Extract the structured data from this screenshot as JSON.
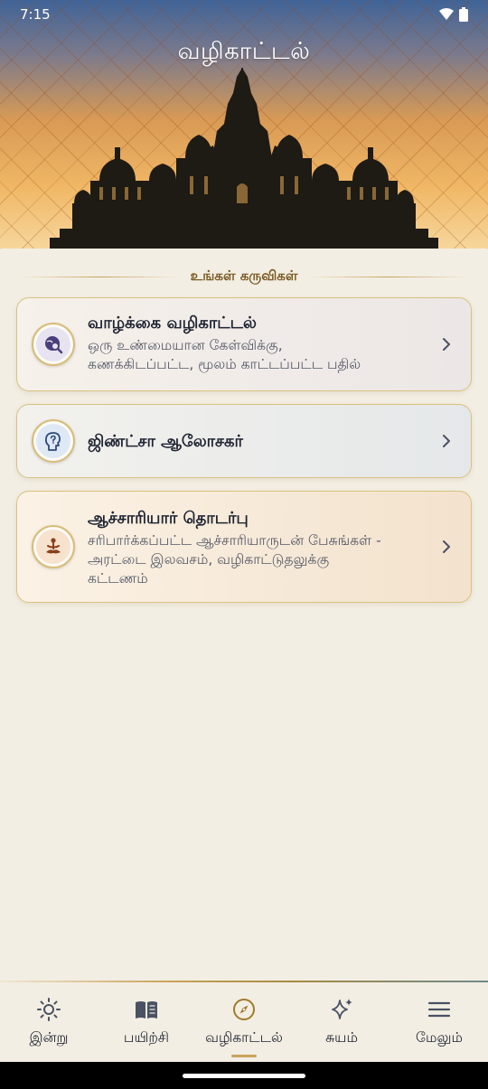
{
  "status_bar": {
    "time": "7:15"
  },
  "header": {
    "title": "வழிகாட்டல்"
  },
  "section": {
    "title": "உங்கள் கருவிகள்"
  },
  "cards": [
    {
      "title": "வாழ்க்கை வழிகாட்டல்",
      "desc_line1": "ஒரு உண்மையான கேள்விக்கு,",
      "desc_line2": "கணக்கிடப்பட்ட, மூலம் காட்டப்பட்ட பதில்",
      "icon": "globe-search-icon"
    },
    {
      "title": "ஜிண்ட்சா ஆலோசகர்",
      "icon": "head-question-icon"
    },
    {
      "title": "ஆச்சாரியார் தொடர்பு",
      "desc_line1": "சரிபார்க்கப்பட்ட ஆச்சாரியாருடன் பேசுங்கள் -",
      "desc_line2": "அரட்டை இலவசம், வழிகாட்டுதலுக்கு",
      "desc_line3": "கட்டணம்",
      "icon": "meditation-icon"
    }
  ],
  "nav": [
    {
      "label": "இன்று",
      "icon": "sun-icon"
    },
    {
      "label": "பயிற்சி",
      "icon": "book-icon"
    },
    {
      "label": "வழிகாட்டல்",
      "icon": "compass-icon",
      "active": true
    },
    {
      "label": "சுயம்",
      "icon": "sparkles-icon"
    },
    {
      "label": "மேலும்",
      "icon": "menu-icon"
    }
  ],
  "colors": {
    "accent_gold": "#c9a25a",
    "text_dark": "#1f2433",
    "background": "#f3eee3"
  }
}
